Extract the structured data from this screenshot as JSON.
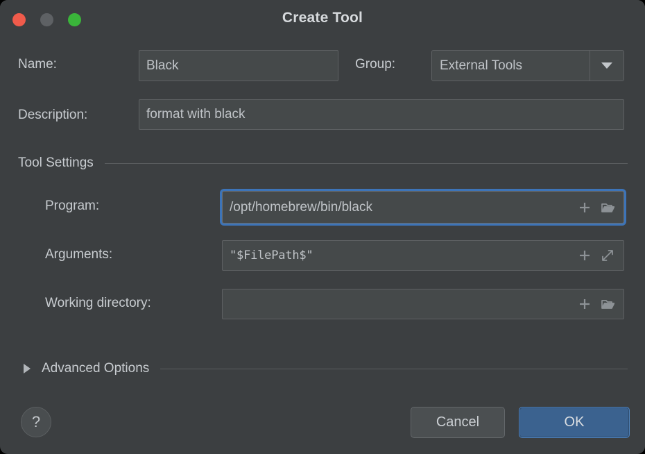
{
  "window": {
    "title": "Create Tool",
    "controls": {
      "close": "close-button",
      "minimize": "minimize-button",
      "zoom": "zoom-button"
    }
  },
  "form": {
    "name": {
      "label": "Name:",
      "value": "Black",
      "placeholder": ""
    },
    "group": {
      "label": "Group:",
      "value": "External Tools",
      "options": [
        "External Tools"
      ]
    },
    "description": {
      "label": "Description:",
      "value": "format with black",
      "placeholder": ""
    }
  },
  "tool_settings": {
    "section_title": "Tool Settings",
    "program": {
      "label": "Program:",
      "value": "/opt/homebrew/bin/black",
      "placeholder": "",
      "focused": true,
      "icons": [
        "plus-icon",
        "open-folder-icon"
      ]
    },
    "arguments": {
      "label": "Arguments:",
      "value": "\"$FilePath$\"",
      "placeholder": "",
      "focused": false,
      "icons": [
        "plus-icon",
        "expand-diagonal-icon"
      ]
    },
    "working_directory": {
      "label": "Working directory:",
      "value": "",
      "placeholder": "",
      "focused": false,
      "icons": [
        "plus-icon",
        "open-folder-icon"
      ]
    }
  },
  "advanced": {
    "title": "Advanced Options",
    "expanded": false
  },
  "footer": {
    "help_label": "?",
    "cancel_label": "Cancel",
    "ok_label": "OK"
  },
  "colors": {
    "dialog_bg": "#3c3f41",
    "field_bg": "#45494a",
    "field_border": "#5e6163",
    "focus_ring": "#3d74b8",
    "ok_bg": "#3b628f",
    "ok_border": "#4f83bd",
    "text": "#c8ccd0",
    "close": "#f05b4b",
    "minimize": "#5e6164",
    "zoom": "#3ab53a"
  }
}
